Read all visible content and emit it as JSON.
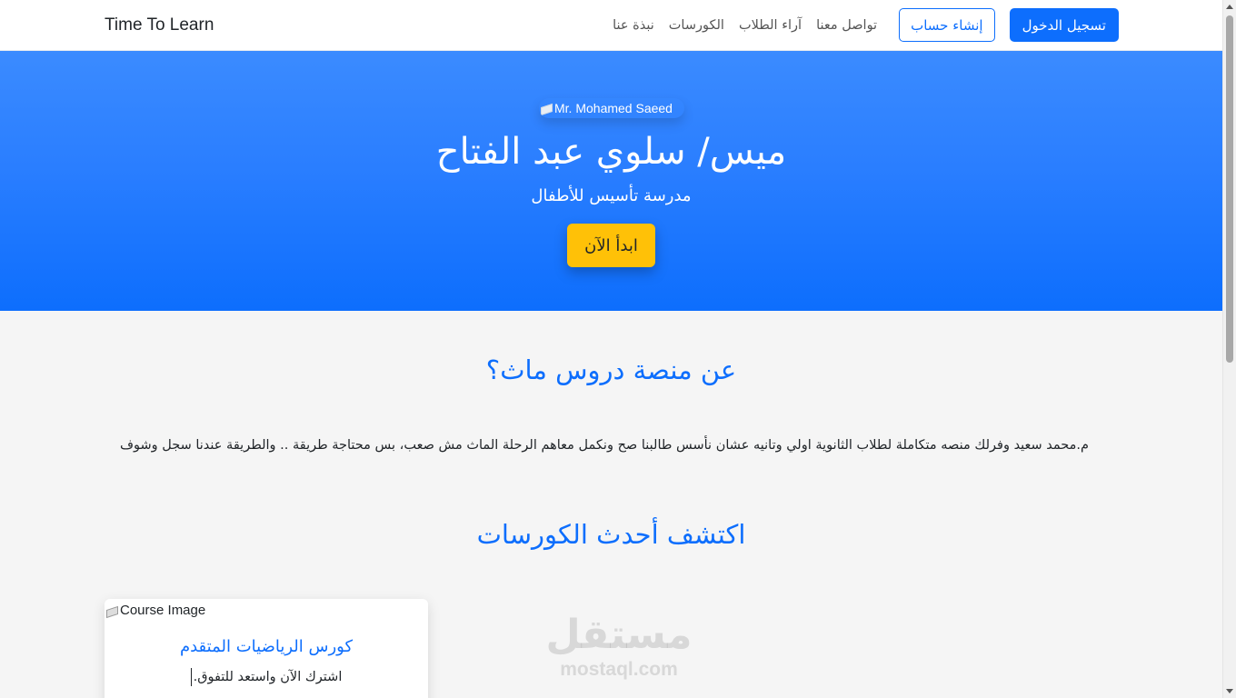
{
  "navbar": {
    "brand": "Time To Learn",
    "login_button": "تسجيل الدخول",
    "register_button": "إنشاء حساب",
    "links": [
      {
        "label": "تواصل معنا"
      },
      {
        "label": "آراء الطلاب"
      },
      {
        "label": "الكورسات"
      },
      {
        "label": "نبذة عنا"
      }
    ]
  },
  "hero": {
    "image_alt": "Mr. Mohamed Saeed",
    "title": "ميس/ سلوي عبد الفتاح",
    "subtitle": "مدرسة تأسيس للأطفال",
    "cta": "ابدأ الآن"
  },
  "about": {
    "title": "عن منصة دروس ماث؟",
    "text": "م.محمد سعيد وفرلك منصه متكاملة لطلاب الثانوية اولي وتانيه عشان نأسس طالبنا صح ونكمل معاهم الرحلة الماث مش صعب، بس محتاجة طريقة .. والطريقة عندنا سجل وشوف"
  },
  "courses": {
    "title": "اكتشف أحدث الكورسات",
    "items": [
      {
        "image_alt": "Course Image",
        "title": "كورس الرياضيات المتقدم",
        "description": "اشترك الآن واستعد للتفوق."
      }
    ]
  },
  "watermark": {
    "arabic": "مستقل",
    "latin": "mostaql.com"
  },
  "colors": {
    "primary": "#0d6efd",
    "cta": "#ffc107",
    "background": "#f5f5f5"
  }
}
